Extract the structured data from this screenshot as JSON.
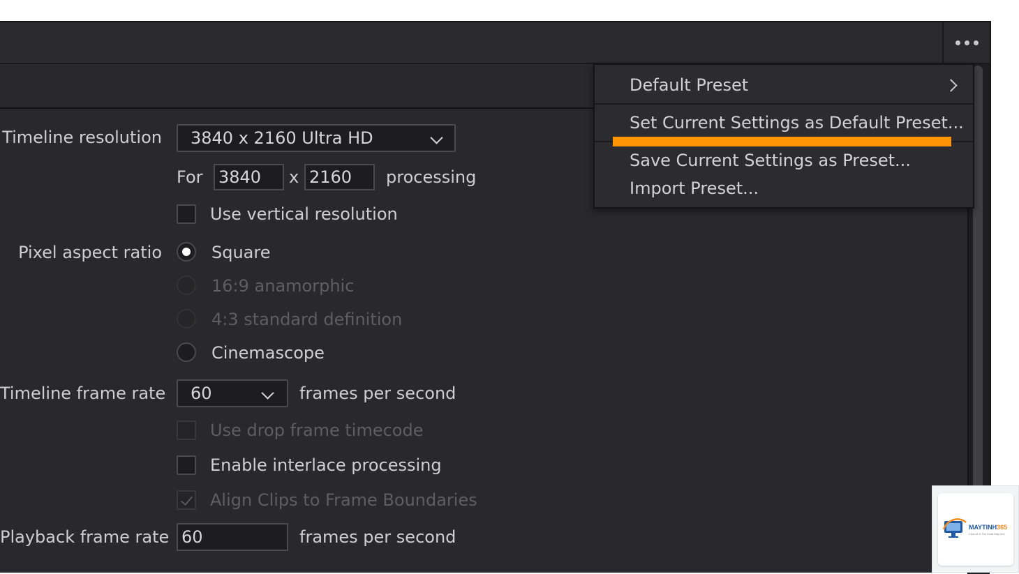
{
  "toolbar": {
    "more_icon": "more-horizontal-icon"
  },
  "menu": {
    "items": [
      {
        "label": "Default Preset",
        "has_submenu": true
      },
      {
        "label": "Set Current Settings as Default Preset..."
      },
      {
        "label": "Save Current Settings as Preset..."
      },
      {
        "label": "Import Preset..."
      }
    ],
    "highlight_color": "#ff9506"
  },
  "resolution": {
    "label": "Timeline resolution",
    "value": "3840 x 2160 Ultra HD",
    "for_label": "For",
    "width": "3840",
    "x_label": "x",
    "height": "2160",
    "processing_label": "processing",
    "vertical_label": "Use vertical resolution"
  },
  "pixel_aspect": {
    "label": "Pixel aspect ratio",
    "options": [
      "Square",
      "16:9 anamorphic",
      "4:3 standard definition",
      "Cinemascope"
    ],
    "selected": "Square"
  },
  "frame_rate": {
    "label": "Timeline frame rate",
    "value": "60",
    "unit": "frames per second",
    "drop_frame_label": "Use drop frame timecode",
    "interlace_label": "Enable interlace processing",
    "align_label": "Align Clips to Frame Boundaries"
  },
  "playback": {
    "label": "Playback frame rate",
    "value": "60",
    "unit": "frames per second"
  },
  "watermark": {
    "brand_main": "MAYTINH",
    "brand_accent": "365",
    "tagline": "Chia sẻ & Thủ thuật Máy tính"
  }
}
